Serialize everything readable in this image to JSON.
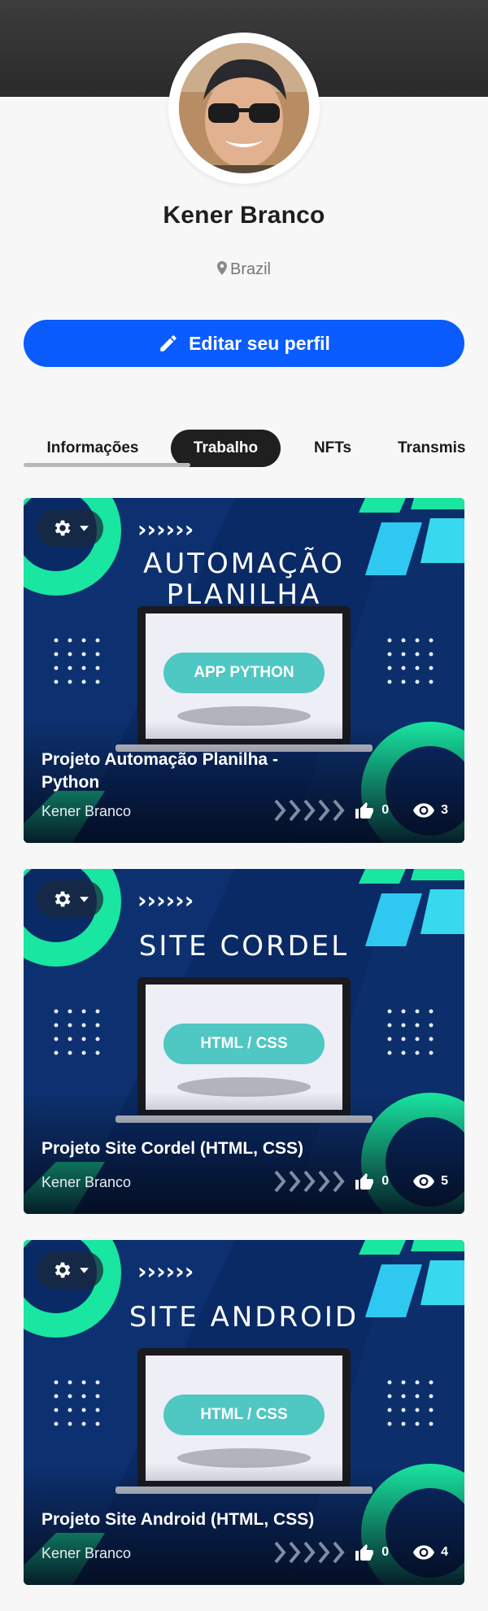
{
  "profile": {
    "name": "Kener Branco",
    "location": "Brazil",
    "edit_label": "Editar seu perfil"
  },
  "tabs": [
    {
      "label": "Informações",
      "active": false
    },
    {
      "label": "Trabalho",
      "active": true
    },
    {
      "label": "NFTs",
      "active": false
    },
    {
      "label": "Transmis",
      "active": false
    }
  ],
  "projects": [
    {
      "banner_title_line1": "AUTOMAÇÃO",
      "banner_title_line2": "PLANILHA",
      "screen_badge": "APP PYTHON",
      "title": "Projeto Automação Planilha - Python",
      "author": "Kener Branco",
      "likes": "0",
      "views": "3"
    },
    {
      "banner_title_line1": "SITE CORDEL",
      "banner_title_line2": "",
      "screen_badge": "HTML / CSS",
      "title": "Projeto Site Cordel (HTML, CSS)",
      "author": "Kener Branco",
      "likes": "0",
      "views": "5"
    },
    {
      "banner_title_line1": "SITE ANDROID",
      "banner_title_line2": "",
      "screen_badge": "HTML / CSS",
      "title": "Projeto Site Android (HTML, CSS)",
      "author": "Kener Branco",
      "likes": "0",
      "views": "4"
    }
  ],
  "colors": {
    "cover": "#333333",
    "primary": "#0a5cff",
    "card_bg": "#0a2a66",
    "accent_green": "#19e6a0",
    "accent_cyan": "#2ec8f0",
    "badge": "#4fc7c3"
  },
  "icons": {
    "location": "map-pin-icon",
    "edit": "pencil-icon",
    "settings": "gear-icon",
    "likes": "thumbs-up-icon",
    "views": "eye-icon"
  }
}
